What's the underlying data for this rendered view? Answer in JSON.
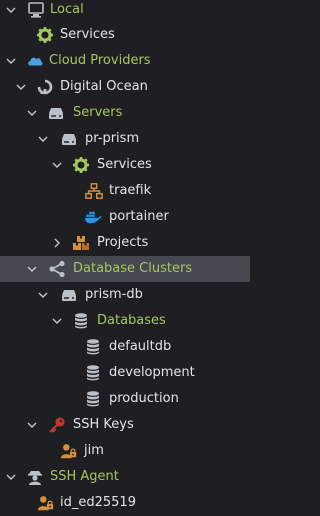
{
  "colors": {
    "background": "#1e1f22",
    "selected_row": "#45494f",
    "group_label": "#a6c65f",
    "item_label": "#e4e4e4",
    "chevron": "#c8c8c8",
    "icon_gray": "#b9c0c8",
    "gear_green": "#a6c65f",
    "cloud_blue": "#4aa3df",
    "key_red": "#c0392b",
    "docker_blue": "#2496ed",
    "projects_orange": "#d9903a"
  },
  "tree": {
    "local": {
      "label": "Local",
      "icon": "computer-icon"
    },
    "local_services": {
      "label": "Services",
      "icon": "gear-icon"
    },
    "cloud_providers": {
      "label": "Cloud Providers",
      "icon": "cloud-icon"
    },
    "digital_ocean": {
      "label": "Digital Ocean",
      "icon": "digital-ocean-icon"
    },
    "servers": {
      "label": "Servers",
      "icon": "server-icon"
    },
    "pr_prism": {
      "label": "pr-prism",
      "icon": "server-icon"
    },
    "prism_services": {
      "label": "Services",
      "icon": "gear-icon"
    },
    "traefik": {
      "label": "traefik",
      "icon": "network-icon"
    },
    "portainer": {
      "label": "portainer",
      "icon": "docker-icon"
    },
    "projects": {
      "label": "Projects",
      "icon": "boxes-icon"
    },
    "database_clusters": {
      "label": "Database Clusters",
      "icon": "share-icon"
    },
    "prism_db": {
      "label": "prism-db",
      "icon": "server-icon"
    },
    "databases": {
      "label": "Databases",
      "icon": "database-icon"
    },
    "defaultdb": {
      "label": "defaultdb",
      "icon": "database-icon"
    },
    "development": {
      "label": "development",
      "icon": "database-icon"
    },
    "production": {
      "label": "production",
      "icon": "database-icon"
    },
    "ssh_keys": {
      "label": "SSH Keys",
      "icon": "key-icon"
    },
    "jim": {
      "label": "jim",
      "icon": "user-key-icon"
    },
    "ssh_agent": {
      "label": "SSH Agent",
      "icon": "agent-icon"
    },
    "id_ed25519": {
      "label": "id_ed25519",
      "icon": "user-key-icon"
    }
  }
}
